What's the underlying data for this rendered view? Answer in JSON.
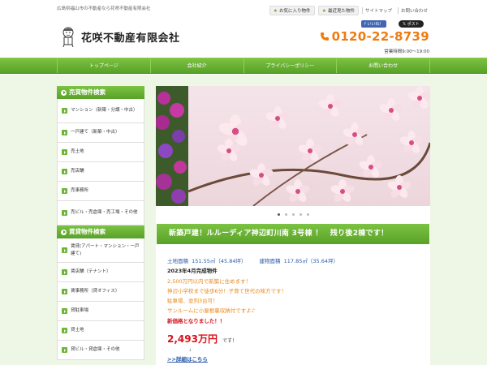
{
  "header": {
    "tagline": "広島県福山市の不動産なら花咲不動産有限会社",
    "top_links": {
      "favorites": "お気に入り物件",
      "recent": "最近見た物件",
      "sitemap": "サイトマップ",
      "contact": "お問い合わせ"
    },
    "social": {
      "facebook": "いいね！",
      "x": "ポスト"
    },
    "company_name": "花咲不動産有限会社",
    "phone": "0120-22-8739",
    "hours": "営業時間9:00～19:00"
  },
  "nav": {
    "items": [
      "トップページ",
      "会社紹介",
      "プライバシーポリシー",
      "お問い合わせ"
    ]
  },
  "sidebar": {
    "sale": {
      "heading": "売買物件検索",
      "items": [
        "マンション（新築・分譲・中古）",
        "一戸建て（新築・中古）",
        "売土地",
        "売店舗",
        "売事務所",
        "売ビル・売倉庫・売工場・その他"
      ]
    },
    "rent": {
      "heading": "賃貸物件検索",
      "items": [
        "賃貸(アパート・マンション・一戸建て)",
        "賃店舗（テナント）",
        "賃事務所（貸オフィス）",
        "貸駐車場",
        "貸土地",
        "貸ビル・貸倉庫・その他"
      ]
    }
  },
  "listing": {
    "title": "新築戸建！ルルーディア神辺町川南 3号棟 ！　残り後2棟です！",
    "land_label": "土地面積",
    "land_value": "151.55㎡（45.84坪）",
    "building_label": "建物面積",
    "building_value": "117.85㎡（35.64坪）",
    "completed": "2023年4月完成物件",
    "lines": [
      "2,500万円以内で新築に住めます！",
      "神辺小学校まで徒歩6分！子育て世代の味方です！",
      "駐車場、並列3台可！",
      "サンルームに小屋根裏収納付ですよ♪"
    ],
    "price_note": "新価格となりました！！",
    "price": "2,493万円",
    "price_suffix": "です！",
    "arrow": "↓",
    "detail_link": ">>詳細はこちら"
  },
  "colors": {
    "brand_green": "#6cb535",
    "phone_orange": "#f07a0e",
    "price_red": "#d8121b",
    "spec_blue": "#2b5aa8"
  }
}
